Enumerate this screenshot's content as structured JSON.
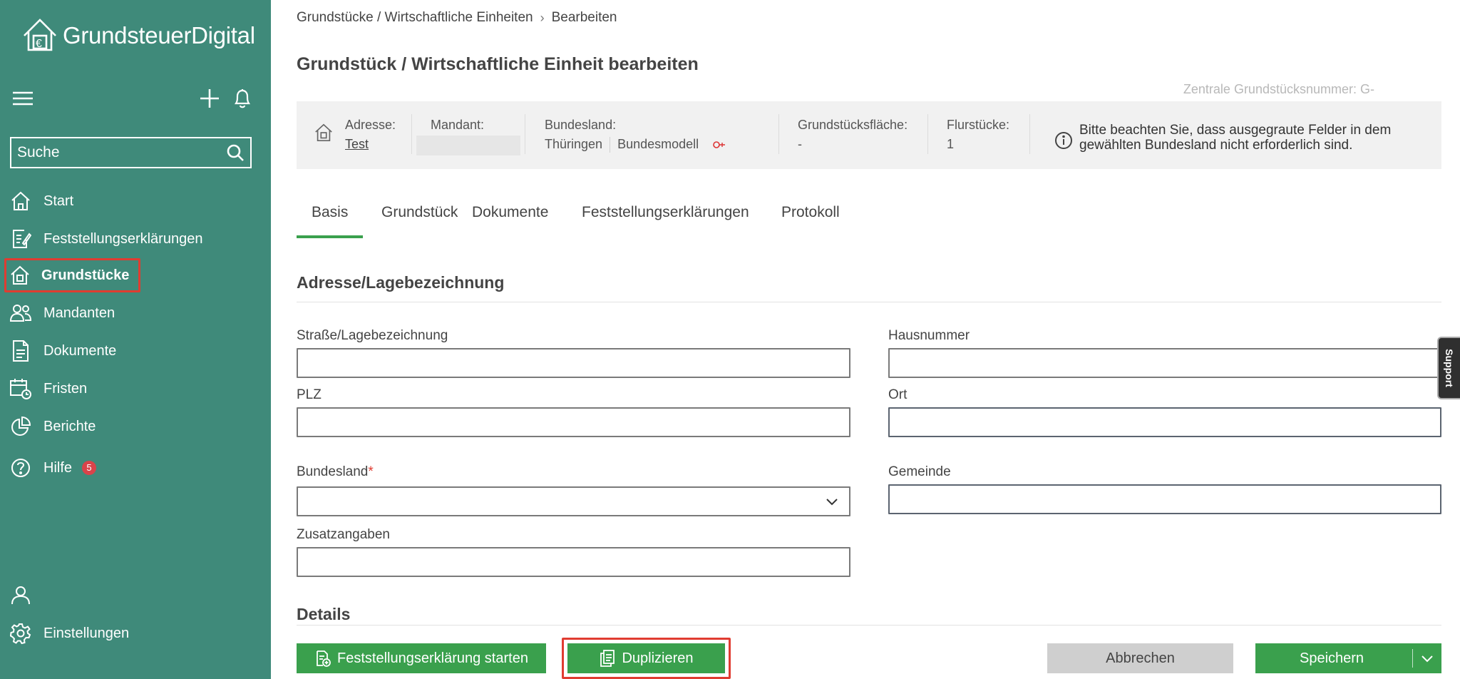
{
  "app": {
    "name": "GrundsteuerDigital",
    "colors": {
      "sidebar": "#3f8a7a",
      "accent_green": "#3aa04d",
      "highlight_red": "#e03c31",
      "info_bar": "#f1f1f1"
    }
  },
  "sidebar": {
    "search_placeholder": "Suche",
    "items": [
      {
        "label": "Start",
        "icon": "home-icon"
      },
      {
        "label": "Feststellungserklärungen",
        "icon": "document-edit-icon"
      },
      {
        "label": "Grundstücke",
        "icon": "property-icon",
        "active": true
      },
      {
        "label": "Mandanten",
        "icon": "users-icon"
      },
      {
        "label": "Dokumente",
        "icon": "document-icon"
      },
      {
        "label": "Fristen",
        "icon": "calendar-clock-icon"
      },
      {
        "label": "Berichte",
        "icon": "pie-chart-icon"
      },
      {
        "label": "Hilfe",
        "icon": "help-icon",
        "badge": "5"
      }
    ],
    "bottom": [
      {
        "label": "",
        "icon": "user-icon"
      },
      {
        "label": "Einstellungen",
        "icon": "gear-icon"
      }
    ]
  },
  "breadcrumb": {
    "parent": "Grundstücke / Wirtschaftliche Einheiten",
    "current": "Bearbeiten"
  },
  "page": {
    "title": "Grundstück / Wirtschaftliche Einheit bearbeiten",
    "zentrale_nummer": "Zentrale Grundstücksnummer: G-"
  },
  "info_bar": {
    "adresse_label": "Adresse:",
    "adresse_value": "Test",
    "mandant_label": "Mandant:",
    "bundesland_label": "Bundesland:",
    "bundesland_value": "Thüringen",
    "modell_value": "Bundesmodell",
    "flaeche_label": "Grundstücksfläche:",
    "flaeche_value": "-",
    "flurstuecke_label": "Flurstücke:",
    "flurstuecke_value": "1",
    "notice": "Bitte beachten Sie, dass ausgegraute Felder in dem gewählten Bundesland nicht erforderlich sind."
  },
  "tabs": [
    "Basis",
    "Grundstück",
    "Dokumente",
    "Feststellungserklärungen",
    "Protokoll"
  ],
  "form": {
    "section_title": "Adresse/Lagebezeichnung",
    "strasse_label": "Straße/Lagebezeichnung",
    "hausnummer_label": "Hausnummer",
    "plz_label": "PLZ",
    "ort_label": "Ort",
    "bundesland_label": "Bundesland",
    "required_mark": "*",
    "gemeinde_label": "Gemeinde",
    "zusatz_label": "Zusatzangaben",
    "details_title": "Details"
  },
  "actions": {
    "start_label": "Feststellungserklärung starten",
    "duplicate_label": "Duplizieren",
    "cancel_label": "Abbrechen",
    "save_label": "Speichern"
  },
  "support_label": "Support"
}
